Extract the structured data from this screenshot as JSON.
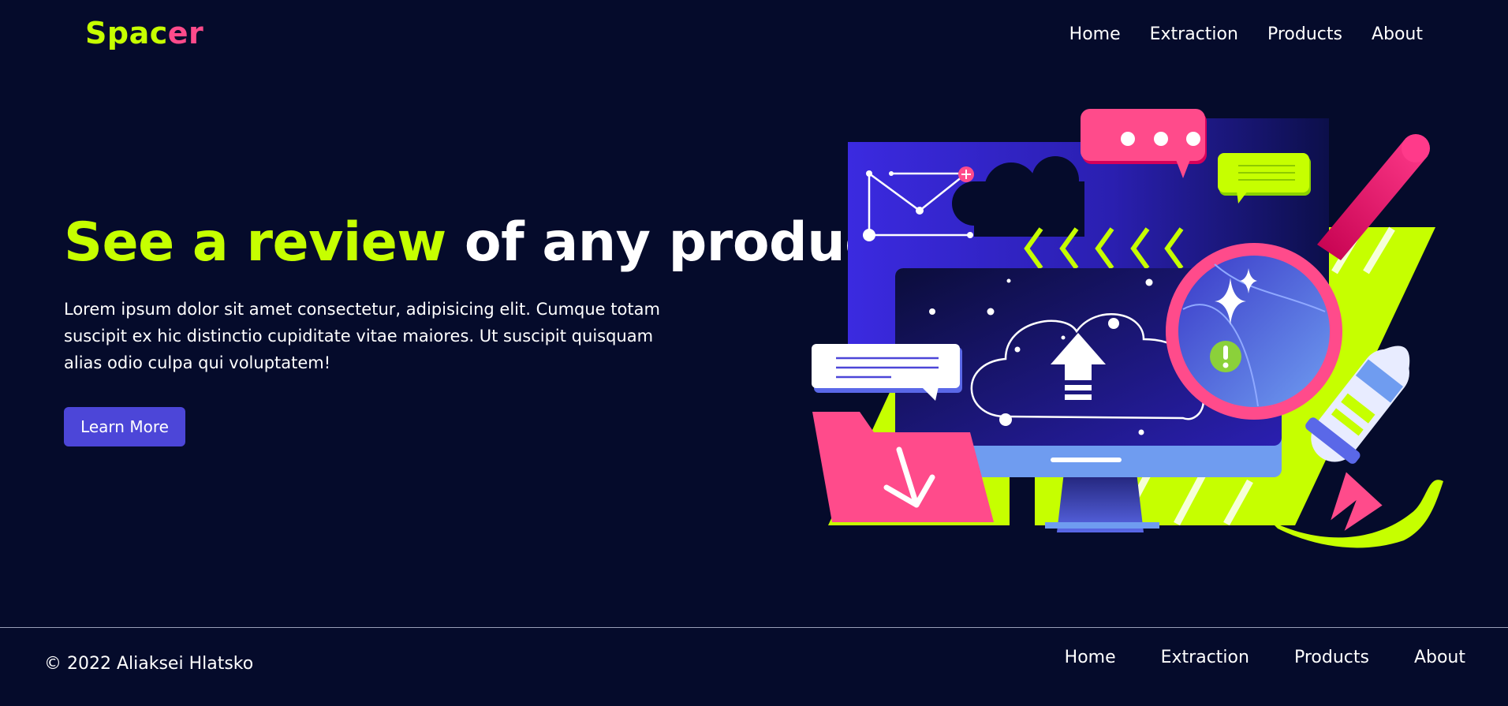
{
  "header": {
    "logo_part1": "Spac",
    "logo_part2": "er",
    "nav": [
      "Home",
      "Extraction",
      "Products",
      "About"
    ]
  },
  "hero": {
    "title_highlight": "See a review",
    "title_rest": " of any product",
    "text": "Lorem ipsum dolor sit amet consectetur, adipisicing elit. Cumque totam suscipit ex hic distinctio cupiditate vitae maiores. Ut suscipit quisquam alias odio culpa qui voluptatem!",
    "button_label": "Learn More"
  },
  "footer": {
    "copyright": "© 2022 Aliaksei Hlatsko",
    "nav": [
      "Home",
      "Extraction",
      "Products",
      "About"
    ]
  },
  "colors": {
    "background": "#050b2b",
    "accent_lime": "#c6ff00",
    "accent_pink": "#ff4b8b",
    "button": "#4c46d8"
  }
}
